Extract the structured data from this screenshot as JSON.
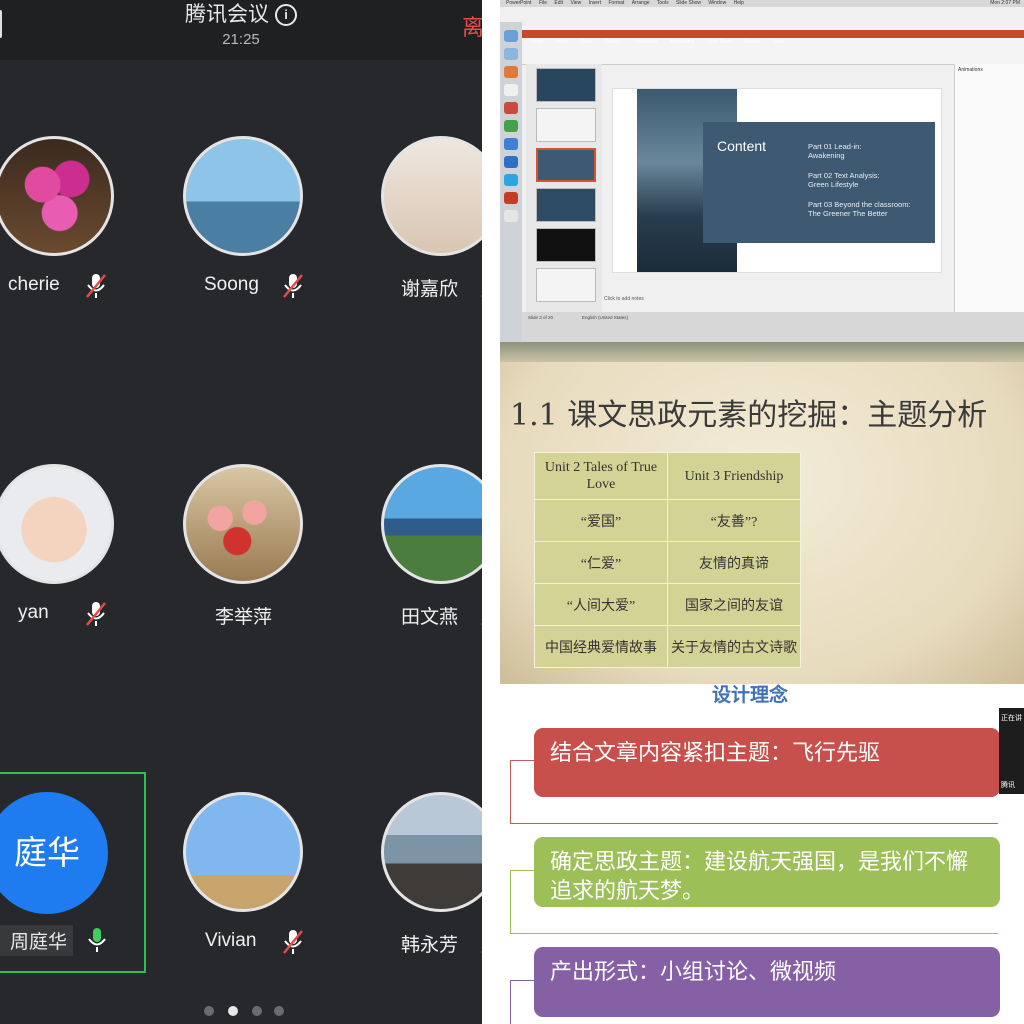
{
  "meeting": {
    "title": "腾讯会议",
    "time": "21:25",
    "leave_label": "离",
    "participants": [
      {
        "name": "cherie",
        "mic": "muted"
      },
      {
        "name": "Soong",
        "mic": "muted"
      },
      {
        "name": "谢嘉欣",
        "mic": "muted"
      },
      {
        "name": "yan",
        "mic": "muted"
      },
      {
        "name": "李举萍",
        "mic": "none"
      },
      {
        "name": "田文燕",
        "mic": "muted"
      },
      {
        "name": "Vivian",
        "mic": "muted"
      },
      {
        "name": "韩永芳",
        "mic": "muted"
      }
    ],
    "self": {
      "avatar_text": "庭华",
      "name": "周庭华",
      "mic": "on"
    },
    "page_dots": {
      "count": 4,
      "active": 2
    }
  },
  "ppt": {
    "menu": [
      "PowerPoint",
      "File",
      "Edit",
      "View",
      "Insert",
      "Format",
      "Arrange",
      "Tools",
      "Slide Show",
      "Window",
      "Help"
    ],
    "clock": "Mon 2:07 PM",
    "tabs": [
      "Home",
      "Insert",
      "Draw",
      "Design",
      "Transitions",
      "Animations",
      "Slide Show",
      "Review",
      "View"
    ],
    "slide": {
      "title": "Content",
      "parts": [
        "Part 01 Lead-in:\nAwakening",
        "Part 02 Text Analysis:\nGreen Lifestyle",
        "Part 03 Beyond the classroom:\nThe Greener The Better"
      ]
    },
    "notes_placeholder": "Click to add notes",
    "animations_panel": "Animations",
    "status_left": "Slide 3 of 20",
    "status_lang": "English (United States)"
  },
  "theme_slide": {
    "title": "1.1 课文思政元素的挖掘：主题分析",
    "headers": [
      "Unit 2 Tales of True Love",
      "Unit 3 Friendship"
    ],
    "rows": [
      [
        "“爱国”",
        "“友善”?"
      ],
      [
        "“仁爱”",
        "友情的真谛"
      ],
      [
        "“人间大爱”",
        "国家之间的友谊"
      ],
      [
        "中国经典爱情故事",
        "关于友情的古文诗歌"
      ]
    ]
  },
  "design": {
    "title": "设计理念",
    "items": [
      {
        "text": "结合文章内容紧扣主题：飞行先驱",
        "color": "#c8504c"
      },
      {
        "text": "确定思政主题：建设航天强国，是我们不懈追求的航天梦。",
        "color": "#9dbf57"
      },
      {
        "text": "产出形式：小组讨论、微视频",
        "color": "#8560a5"
      }
    ],
    "mini_label": "正在讲",
    "mini_footer": "腾讯"
  }
}
